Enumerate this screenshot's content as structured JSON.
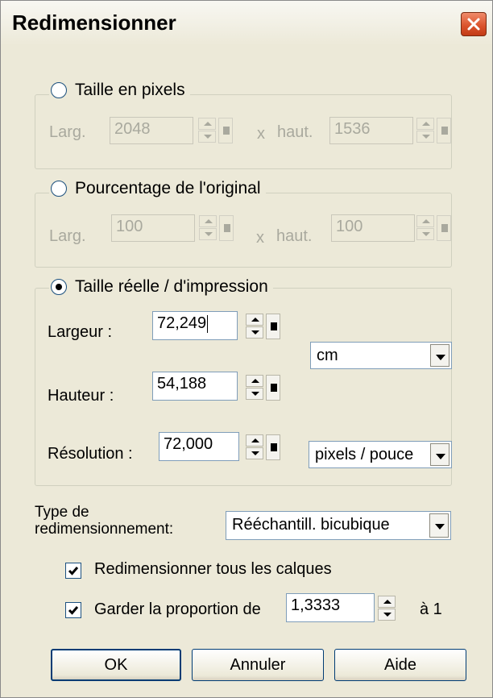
{
  "window": {
    "title": "Redimensionner",
    "close_icon": "close-icon"
  },
  "pixel_size": {
    "legend": "Taille en pixels",
    "selected": false,
    "width_label": "Larg.",
    "width_value": "2048",
    "times": "x",
    "height_label": "haut.",
    "height_value": "1536"
  },
  "percent": {
    "legend": "Pourcentage de l'original",
    "selected": false,
    "width_label": "Larg.",
    "width_value": "100",
    "times": "x",
    "height_label": "haut.",
    "height_value": "100"
  },
  "print_size": {
    "legend": "Taille réelle / d'impression",
    "selected": true,
    "width_label": "Largeur :",
    "width_value": "72,249",
    "height_label": "Hauteur :",
    "height_value": "54,188",
    "resolution_label": "Résolution :",
    "resolution_value": "72,000",
    "unit_selected": "cm",
    "res_unit_selected": "pixels / pouce"
  },
  "resample": {
    "label_line1": "Type de",
    "label_line2": "redimensionnement:",
    "selected": "Rééchantill. bicubique"
  },
  "options": {
    "all_layers_label": "Redimensionner tous les calques",
    "all_layers_checked": true,
    "keep_ratio_label": "Garder la proportion de",
    "keep_ratio_checked": true,
    "ratio_value": "1,3333",
    "ratio_suffix": "à 1"
  },
  "buttons": {
    "ok": "OK",
    "cancel": "Annuler",
    "help": "Aide"
  },
  "colors": {
    "dialog_bg": "#ece9d8",
    "close_bg": "#d9512a",
    "focus_border": "#003c74",
    "disabled_text": "#a9a99e"
  }
}
